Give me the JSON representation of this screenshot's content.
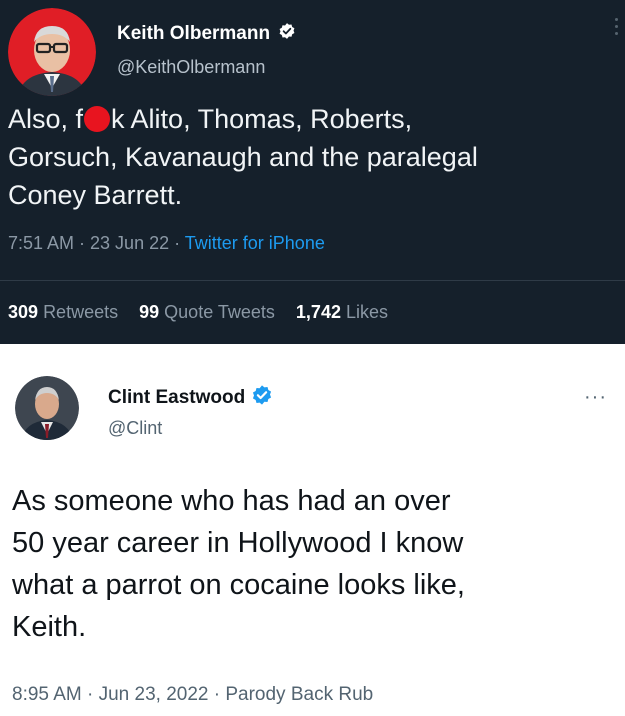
{
  "tweet1": {
    "name": "Keith Olbermann",
    "handle": "@KeithOlbermann",
    "body": {
      "line1_pre": "Also, f",
      "line1_post": "k Alito, Thomas, Roberts,",
      "line2": "Gorsuch, Kavanaugh and the paralegal",
      "line3": "Coney Barrett."
    },
    "time": "7:51 AM · 23 Jun 22 · ",
    "app": "Twitter for iPhone",
    "stats": {
      "retweets_count": "309",
      "retweets_label": "Retweets",
      "quotes_count": "99",
      "quotes_label": "Quote Tweets",
      "likes_count": "1,742",
      "likes_label": "Likes"
    },
    "verified_badge_color": "#ffffff",
    "censor_color": "#e8141f"
  },
  "tweet2": {
    "name": "Clint Eastwood",
    "handle": "@Clint",
    "more": "···",
    "body": {
      "line1": "As someone who has had an over",
      "line2": "50 year career in Hollywood I know",
      "line3": "what a parrot on cocaine looks like,",
      "line4": "Keith."
    },
    "meta": "8:95 AM · Jun 23, 2022 · Parody Back Rub",
    "verified_badge_color": "#1d9bf0"
  }
}
